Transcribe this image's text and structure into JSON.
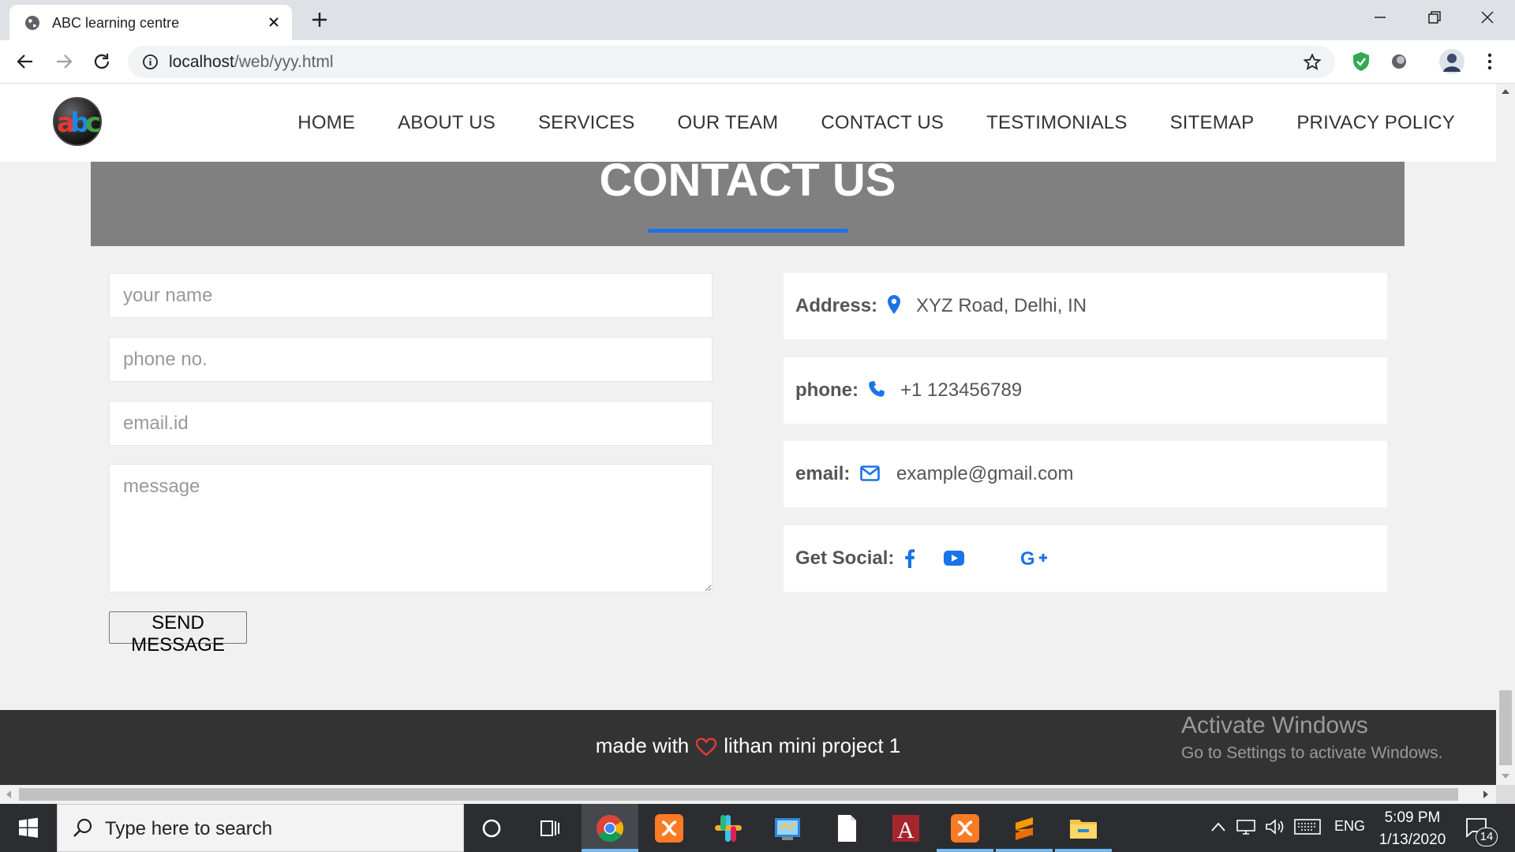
{
  "browser": {
    "tab_title": "ABC learning centre",
    "url_host": "localhost",
    "url_path": "/web/yyy.html"
  },
  "site": {
    "logo_text": "abc",
    "nav": [
      "HOME",
      "ABOUT US",
      "SERVICES",
      "OUR TEAM",
      "CONTACT US",
      "TESTIMONIALS",
      "SITEMAP",
      "PRIVACY POLICY"
    ],
    "hero_title": "CONTACT US"
  },
  "form": {
    "name_placeholder": "your name",
    "phone_placeholder": "phone no.",
    "email_placeholder": "email.id",
    "message_placeholder": "message",
    "send_label": "SEND MESSAGE"
  },
  "contact": {
    "address_label": "Address:",
    "address_value": "XYZ Road, Delhi, IN",
    "phone_label": "phone:",
    "phone_value": "+1 123456789",
    "email_label": "email:",
    "email_value": "example@gmail.com",
    "social_label": "Get Social:",
    "social_icons": [
      "facebook-icon",
      "youtube-icon",
      "google-plus-icon"
    ]
  },
  "footer": {
    "made_with": "made with",
    "credit": "lithan mini project 1"
  },
  "watermark": {
    "line1": "Activate Windows",
    "line2": "Go to Settings to activate Windows."
  },
  "taskbar": {
    "search_placeholder": "Type here to search",
    "language": "ENG",
    "time": "5:09 PM",
    "date": "1/13/2020",
    "notifications": "14"
  },
  "colors": {
    "accent": "#1a73e8",
    "hero_bg": "#808080",
    "footer_bg": "#333333",
    "heart": "#e53935"
  }
}
